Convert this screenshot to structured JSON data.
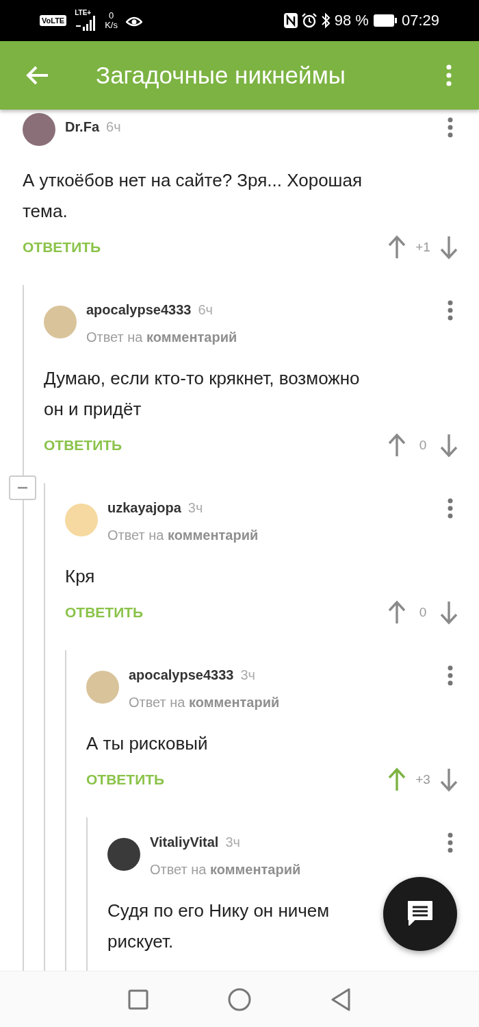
{
  "status_bar": {
    "volte": "VoLTE",
    "network": "LTE+",
    "speed_value": "0",
    "speed_unit": "K/s",
    "battery": "98 %",
    "time": "07:29"
  },
  "app_bar": {
    "title": "Загадочные никнеймы"
  },
  "comments": [
    {
      "author": "Dr.Fa",
      "time": "6ч",
      "avatar": {
        "color": "#8a6f78"
      },
      "text": "А уткоёбов нет на сайте? Зря... Хорошая\nтема.",
      "reply_label": "ОТВЕТИТЬ",
      "rating": "+1",
      "upvoted": false,
      "children": [
        {
          "author": "apocalypse4333",
          "time": "6ч",
          "avatar": {
            "color": "#d9c39a"
          },
          "reply_to": "Ответ на **комментарий**",
          "text": "Думаю, если кто-то крякнет, возможно\nон и придёт",
          "reply_label": "ОТВЕТИТЬ",
          "rating": "0",
          "upvoted": false,
          "collapse": {
            "expanded": true
          },
          "children": [
            {
              "author": "uzkayajopa",
              "time": "3ч",
              "avatar": {
                "color": "#f6d9a0"
              },
              "reply_to": "Ответ на **комментарий**",
              "text": "Кря",
              "reply_label": "ОТВЕТИТЬ",
              "rating": "0",
              "upvoted": false,
              "children": [
                {
                  "author": "apocalypse4333",
                  "time": "3ч",
                  "avatar": {
                    "color": "#d9c39a"
                  },
                  "reply_to": "Ответ на **комментарий**",
                  "text": "А ты рисковый",
                  "reply_label": "ОТВЕТИТЬ",
                  "rating": "+3",
                  "upvoted": true,
                  "children": [
                    {
                      "author": "VitaliyVital",
                      "time": "3ч",
                      "avatar": {
                        "color": "#3a3a3a"
                      },
                      "reply_to": "Ответ на **комментарий**",
                      "text": "Судя по его Нику он ничем\nрискует."
                    }
                  ]
                }
              ]
            }
          ]
        }
      ]
    }
  ]
}
